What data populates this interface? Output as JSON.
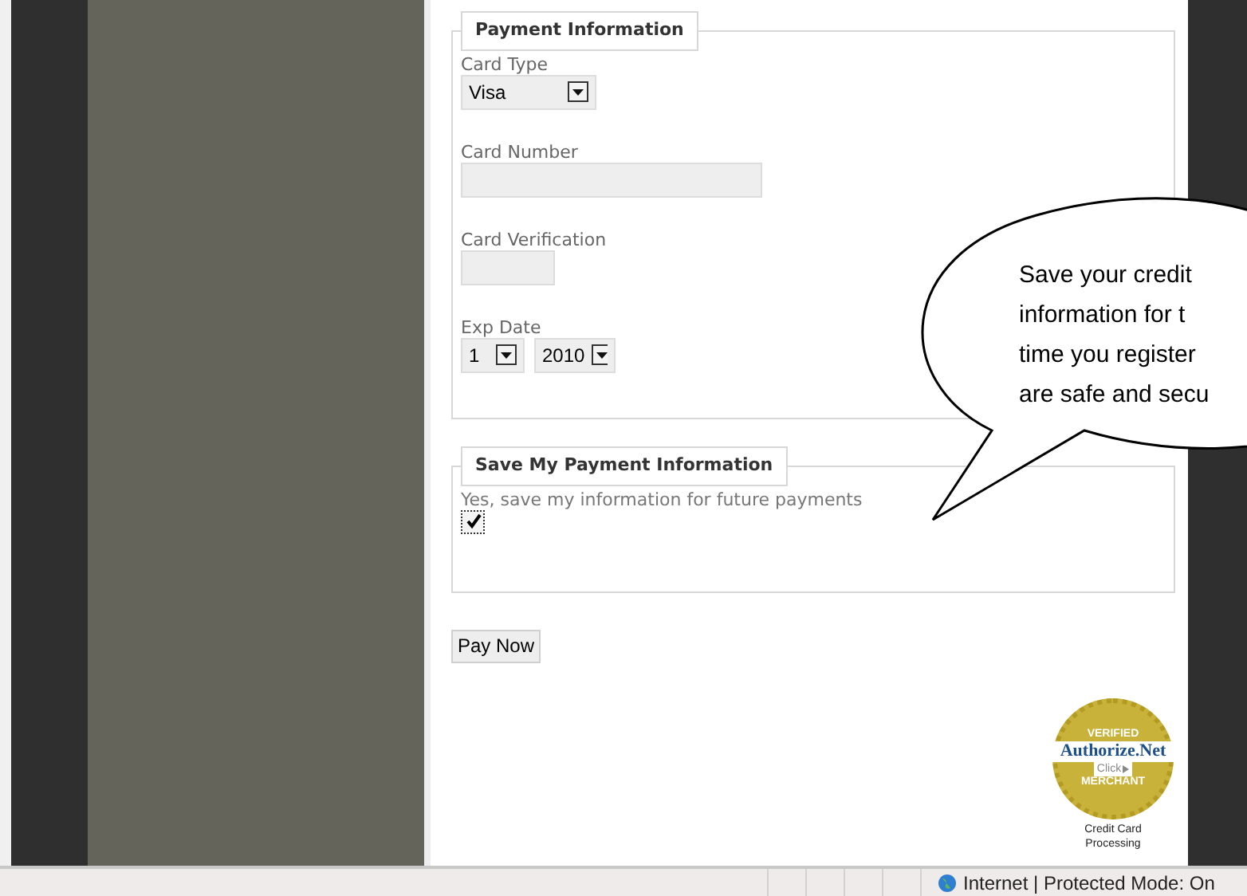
{
  "payment_section": {
    "legend": "Payment Information",
    "fields": [
      {
        "kind": "select",
        "label": "Card Type",
        "value": "Visa"
      },
      {
        "kind": "wide_text",
        "label": "Card Number"
      },
      {
        "kind": "short_text",
        "label": "Card Verification"
      },
      {
        "kind": "date",
        "label": "Exp Date",
        "month": "1",
        "year": "2010"
      }
    ]
  },
  "save_section": {
    "legend": "Save My Payment Information",
    "option": {
      "label": "Yes, save my information for future payments",
      "checked": true
    }
  },
  "pay_button": "Pay Now",
  "callout": {
    "lines": [
      "Save your credit",
      "information for t",
      "time you register",
      "are safe and secu"
    ]
  },
  "seal": {
    "top": "VERIFIED",
    "brand": "Authorize.Net",
    "click": "Click",
    "bottom": "MERCHANT",
    "caption": [
      "Credit Card",
      "Processing"
    ]
  },
  "status_bar": {
    "zone": "Internet | Protected Mode: On"
  }
}
